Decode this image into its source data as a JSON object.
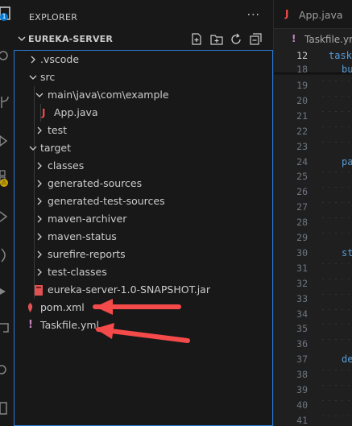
{
  "activity_bar": {
    "icons": [
      "explorer-icon",
      "search-icon",
      "source-control-icon",
      "run-debug-icon",
      "extensions-icon",
      "testing-icon",
      "remote-icon",
      "accounts-icon"
    ],
    "explorer_badge": "1",
    "warning_badge": "⚠",
    "accent": "#0078d4"
  },
  "explorer": {
    "title": "EXPLORER",
    "more_icon": "···",
    "project": "EUREKA-SERVER",
    "actions": [
      "new-file-icon",
      "new-folder-icon",
      "refresh-icon",
      "collapse-all-icon"
    ],
    "items": [
      {
        "label": ".vscode",
        "type": "folder",
        "open": false
      },
      {
        "label": "src",
        "type": "folder",
        "open": true
      },
      {
        "label": "main\\java\\com\\example",
        "type": "folder",
        "open": true
      },
      {
        "label": "App.java",
        "type": "java"
      },
      {
        "label": "test",
        "type": "folder",
        "open": false
      },
      {
        "label": "target",
        "type": "folder",
        "open": true
      },
      {
        "label": "classes",
        "type": "folder",
        "open": false
      },
      {
        "label": "generated-sources",
        "type": "folder",
        "open": false
      },
      {
        "label": "generated-test-sources",
        "type": "folder",
        "open": false
      },
      {
        "label": "maven-archiver",
        "type": "folder",
        "open": false
      },
      {
        "label": "maven-status",
        "type": "folder",
        "open": false
      },
      {
        "label": "surefire-reports",
        "type": "folder",
        "open": false
      },
      {
        "label": "test-classes",
        "type": "folder",
        "open": false
      },
      {
        "label": "eureka-server-1.0-SNAPSHOT.jar",
        "type": "jar"
      },
      {
        "label": "pom.xml",
        "type": "xml"
      },
      {
        "label": "Taskfile.yml",
        "type": "yml"
      }
    ]
  },
  "editor": {
    "tab": {
      "icon": "J",
      "label": "App.java"
    },
    "breadcrumb": {
      "icon": "!",
      "label": "Taskfile.yml"
    },
    "sticky_lines": [
      {
        "num": "12",
        "text": "task"
      },
      {
        "num": "18",
        "text": "bu"
      }
    ],
    "lines": [
      {
        "num": "19",
        "text": ""
      },
      {
        "num": "20",
        "text": ""
      },
      {
        "num": "21",
        "text": ""
      },
      {
        "num": "22",
        "text": ""
      },
      {
        "num": "23",
        "text": ""
      },
      {
        "num": "24",
        "text": "pa"
      },
      {
        "num": "25",
        "text": ""
      },
      {
        "num": "26",
        "text": ""
      },
      {
        "num": "27",
        "text": ""
      },
      {
        "num": "28",
        "text": ""
      },
      {
        "num": "29",
        "text": ""
      },
      {
        "num": "30",
        "text": "st"
      },
      {
        "num": "31",
        "text": ""
      },
      {
        "num": "32",
        "text": ""
      },
      {
        "num": "33",
        "text": ""
      },
      {
        "num": "34",
        "text": ""
      },
      {
        "num": "35",
        "text": ""
      },
      {
        "num": "36",
        "text": ""
      },
      {
        "num": "37",
        "text": "de"
      },
      {
        "num": "38",
        "text": ""
      },
      {
        "num": "39",
        "text": ""
      },
      {
        "num": "40",
        "text": ""
      },
      {
        "num": "41",
        "text": ""
      }
    ]
  },
  "colors": {
    "java": "#f14c4c",
    "jar": "#e05252",
    "xml": "#e05252",
    "yml": "#c586c0",
    "focus_border": "#2b79d6",
    "arrow": "#f44a4a"
  }
}
